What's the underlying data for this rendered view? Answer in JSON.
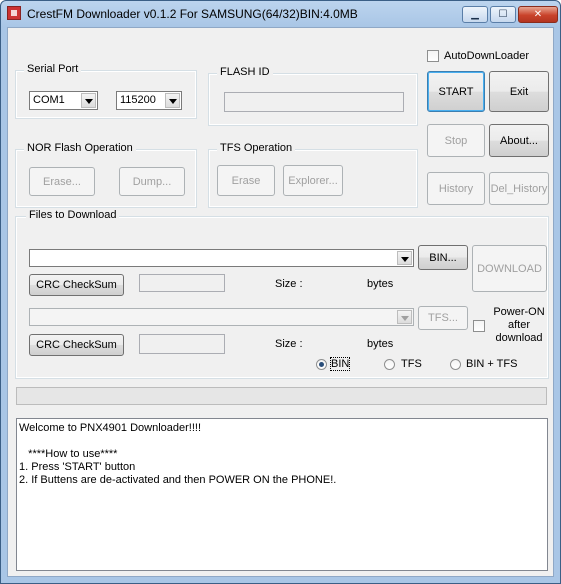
{
  "window": {
    "title": "CrestFM Downloader v0.1.2 For SAMSUNG(64/32)BIN:4.0MB",
    "buttons": {
      "minimize": "▁",
      "maximize": "☐",
      "close": "✕"
    }
  },
  "serial_port": {
    "title": "Serial Port",
    "port": "COM1",
    "baud": "115200"
  },
  "flash_id": {
    "title": "FLASH ID",
    "value": ""
  },
  "auto_downloader": {
    "label": "AutoDownLoader",
    "checked": false
  },
  "actions": {
    "start": "START",
    "exit": "Exit",
    "stop": "Stop",
    "about": "About...",
    "history": "History",
    "del_history": "Del_History"
  },
  "nor_flash": {
    "title": "NOR Flash Operation",
    "erase": "Erase...",
    "dump": "Dump..."
  },
  "tfs_operation": {
    "title": "TFS Operation",
    "erase": "Erase",
    "explorer": "Explorer..."
  },
  "files": {
    "title": "Files to Download",
    "bin_path": "",
    "bin_button": "BIN...",
    "download_button": "DOWNLOAD",
    "crc_button_1": "CRC CheckSum",
    "size_label_1": "Size :",
    "bytes_label_1": "bytes",
    "tfs_path": "",
    "tfs_button": "TFS...",
    "power_on_label": "Power-ON after download",
    "crc_button_2": "CRC CheckSum",
    "size_label_2": "Size :",
    "bytes_label_2": "bytes",
    "mode_options": [
      "BIN",
      "TFS",
      "BIN + TFS"
    ],
    "selected_mode": "BIN"
  },
  "progress": 0,
  "log": {
    "lines": [
      "Welcome to PNX4901 Downloader!!!!",
      "",
      "   ****How to use****",
      "1. Press 'START' button",
      "2. If Buttens are de-activated and then POWER ON the PHONE!."
    ]
  }
}
